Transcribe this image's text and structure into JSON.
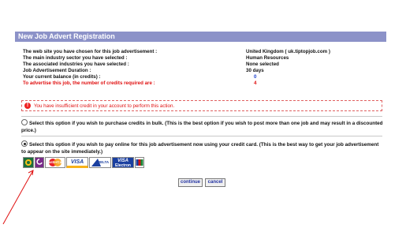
{
  "header": {
    "title": "New Job Advert Registration"
  },
  "summary": [
    {
      "label": "The web site you have chosen for this job advertisement :",
      "value": "United Kingdom ( uk.tiptopjob.com )"
    },
    {
      "label": "The main industry sector you have selected :",
      "value": "Human Resources"
    },
    {
      "label": "The associated industries you have selected :",
      "value": "None selected"
    },
    {
      "label": "Job Advertisement Duration :",
      "value": "30 days"
    },
    {
      "label": "Your current balance (in credits) :",
      "value": "0"
    },
    {
      "label": "To advertise this job, the number of credits required are :",
      "value": "4"
    }
  ],
  "error": {
    "message": "You have insufficient credit in your account to perform this action."
  },
  "options": {
    "bulk": "Select this option if you wish to purchase credits in bulk. (This is the best option if you wish to post more than one job and may result in a discounted price.)",
    "card": "Select this option if you wish to pay online for this job advertisement now using your credit card. (This is the best way to get your job advertisement to appear on the site immediately.)"
  },
  "cards": {
    "mastercard": "MasterCard",
    "visa": "VISA",
    "delta": "DELTA",
    "visa_electron": "VISA",
    "electron": "Electron"
  },
  "buttons": {
    "continue": "continue",
    "cancel": "cancel"
  },
  "colors": {
    "title_bar": "#8c92c8",
    "error": "#e01010",
    "value_blue": "#1a3fd0",
    "arrow": "#e01010"
  }
}
